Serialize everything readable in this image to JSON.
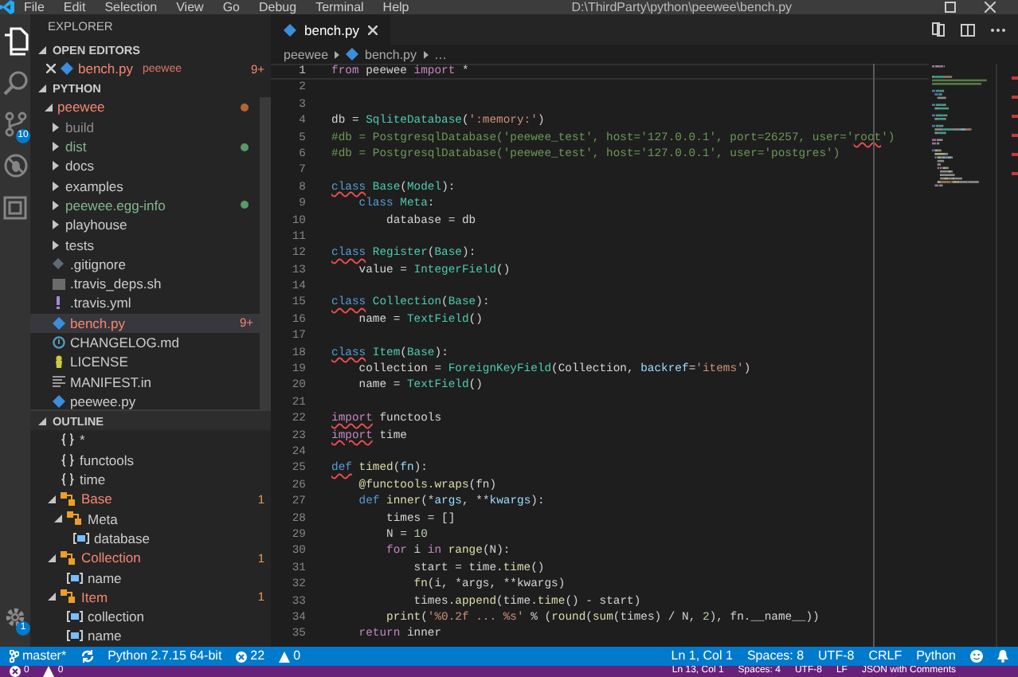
{
  "window": {
    "menu": [
      "File",
      "Edit",
      "Selection",
      "View",
      "Go",
      "Debug",
      "Terminal",
      "Help"
    ],
    "title": "D:\\ThirdParty\\python\\peewee\\bench.py"
  },
  "activity_bar": {
    "items": [
      {
        "selected": true
      },
      {
        "selected": false
      },
      {
        "selected": false,
        "badge": "10"
      },
      {
        "selected": false
      },
      {
        "selected": false
      }
    ],
    "settings": {
      "badge": "1"
    }
  },
  "sidebar": {
    "title": "EXPLORER",
    "open_editors": {
      "title": "OPEN EDITORS",
      "expanded": true,
      "items": [
        {
          "label": "bench.py",
          "description": "peewee",
          "color": "#f48771",
          "badge": "9+",
          "kind": "python"
        }
      ]
    },
    "folder": {
      "title": "PYTHON",
      "expanded": true,
      "items": [
        {
          "label": "peewee",
          "kind": "folder",
          "color": "#f48771",
          "dot": {
            "color": "#b5652e"
          },
          "expanded": true,
          "selected": false,
          "children": [
            {
              "label": "build",
              "kind": "folder",
              "color": "#8c8c8c",
              "expanded": false,
              "selected": false
            },
            {
              "label": "dist",
              "kind": "folder",
              "color": "#81b88b",
              "dot": {
                "color": "#5a9a66"
              },
              "expanded": false,
              "selected": false
            },
            {
              "label": "docs",
              "kind": "folder",
              "color": "#cccccc",
              "expanded": false,
              "selected": false
            },
            {
              "label": "examples",
              "kind": "folder",
              "color": "#cccccc",
              "expanded": false,
              "selected": false
            },
            {
              "label": "peewee.egg-info",
              "kind": "folder",
              "color": "#81b88b",
              "dot": {
                "color": "#5a9a66"
              },
              "expanded": false,
              "selected": false
            },
            {
              "label": "playhouse",
              "kind": "folder",
              "color": "#cccccc",
              "expanded": false,
              "selected": false
            },
            {
              "label": "tests",
              "kind": "folder",
              "color": "#cccccc",
              "expanded": false,
              "selected": false
            },
            {
              "label": ".gitignore",
              "kind": "git",
              "color": "#cccccc",
              "selected": false
            },
            {
              "label": ".travis_deps.sh",
              "kind": "shell",
              "color": "#cccccc",
              "selected": false
            },
            {
              "label": ".travis.yml",
              "kind": "yaml",
              "color": "#cccccc",
              "selected": false
            },
            {
              "label": "bench.py",
              "kind": "python",
              "color": "#f48771",
              "badge": "9+",
              "selected": true
            },
            {
              "label": "CHANGELOG.md",
              "kind": "markdown",
              "color": "#cccccc",
              "selected": false
            },
            {
              "label": "LICENSE",
              "kind": "license",
              "color": "#cccccc",
              "selected": false
            },
            {
              "label": "MANIFEST.in",
              "kind": "manifest",
              "color": "#cccccc",
              "selected": false
            },
            {
              "label": "peewee.py",
              "kind": "python",
              "color": "#cccccc",
              "selected": false
            }
          ]
        }
      ]
    },
    "outline": {
      "title": "OUTLINE",
      "expanded": true,
      "items": [
        {
          "label": "*",
          "kind": "module"
        },
        {
          "label": "functools",
          "kind": "module"
        },
        {
          "label": "time",
          "kind": "module"
        },
        {
          "label": "Base",
          "kind": "class",
          "color": "#f48771",
          "badge": "1",
          "expanded": true,
          "children": [
            {
              "label": "Meta",
              "kind": "class",
              "color": "#cccccc",
              "expanded": true,
              "children": [
                {
                  "label": "database",
                  "kind": "field",
                  "color": "#cccccc"
                }
              ]
            }
          ]
        },
        {
          "label": "Collection",
          "kind": "class",
          "color": "#f48771",
          "badge": "1",
          "expanded": true,
          "children": [
            {
              "label": "name",
              "kind": "field",
              "color": "#cccccc"
            }
          ]
        },
        {
          "label": "Item",
          "kind": "class",
          "color": "#f48771",
          "badge": "1",
          "expanded": true,
          "children": [
            {
              "label": "collection",
              "kind": "field",
              "color": "#cccccc"
            },
            {
              "label": "name",
              "kind": "field",
              "color": "#cccccc"
            }
          ]
        }
      ]
    }
  },
  "editor": {
    "tabs": [
      {
        "label": "bench.py",
        "selected": true
      }
    ],
    "breadcrumbs": [
      "peewee",
      "bench.py",
      "…"
    ],
    "lines": [
      {
        "number": "1",
        "current": true,
        "tokens": [
          {
            "text": "from",
            "color": "#c586c0"
          },
          {
            "text": " peewee "
          },
          {
            "text": "import",
            "color": "#c586c0"
          },
          {
            "text": " *"
          }
        ]
      },
      {
        "number": "2",
        "current": false
      },
      {
        "number": "3",
        "current": false
      },
      {
        "number": "4",
        "current": false,
        "tokens": [
          {
            "text": "db = "
          },
          {
            "text": "SqliteDatabase",
            "color": "#4ec9b0"
          },
          {
            "text": "("
          },
          {
            "text": "':memory:'",
            "color": "#ce9178"
          },
          {
            "text": ")"
          }
        ]
      },
      {
        "number": "5",
        "current": false,
        "tokens": [
          {
            "text": "#db = PostgresqlDatabase('peewee_test', host='127.0.0.1', port=26257, user='",
            "color": "#6a9955"
          },
          {
            "text": "root",
            "color": "#6a9955",
            "squiggle": true
          },
          {
            "text": "')",
            "color": "#6a9955"
          }
        ]
      },
      {
        "number": "6",
        "current": false,
        "tokens": [
          {
            "text": "#db = PostgresqlDatabase('peewee_test', host='127.0.0.1', user='postgres')",
            "color": "#6a9955"
          }
        ]
      },
      {
        "number": "7",
        "current": false
      },
      {
        "number": "8",
        "current": false,
        "tokens": [
          {
            "text": "class",
            "color": "#569cd6",
            "squiggle": true
          },
          {
            "text": " Base",
            "color": "#4ec9b0"
          },
          {
            "text": "("
          },
          {
            "text": "Model",
            "color": "#4ec9b0"
          },
          {
            "text": "):"
          }
        ]
      },
      {
        "number": "9",
        "current": false,
        "tokens": [
          {
            "text": "    class",
            "color": "#569cd6"
          },
          {
            "text": " Meta",
            "color": "#4ec9b0"
          },
          {
            "text": ":"
          }
        ]
      },
      {
        "number": "10",
        "current": false,
        "tokens": [
          {
            "text": "        database = db"
          }
        ]
      },
      {
        "number": "11",
        "current": false
      },
      {
        "number": "12",
        "current": false,
        "tokens": [
          {
            "text": "class",
            "color": "#569cd6",
            "squiggle": true
          },
          {
            "text": " Register",
            "color": "#4ec9b0"
          },
          {
            "text": "("
          },
          {
            "text": "Base",
            "color": "#4ec9b0"
          },
          {
            "text": "):"
          }
        ]
      },
      {
        "number": "13",
        "current": false,
        "tokens": [
          {
            "text": "    value = "
          },
          {
            "text": "IntegerField",
            "color": "#4ec9b0"
          },
          {
            "text": "()"
          }
        ]
      },
      {
        "number": "14",
        "current": false
      },
      {
        "number": "15",
        "current": false,
        "tokens": [
          {
            "text": "class",
            "color": "#569cd6",
            "squiggle": true
          },
          {
            "text": " Collection",
            "color": "#4ec9b0"
          },
          {
            "text": "("
          },
          {
            "text": "Base",
            "color": "#4ec9b0"
          },
          {
            "text": "):"
          }
        ]
      },
      {
        "number": "16",
        "current": false,
        "tokens": [
          {
            "text": "    name = "
          },
          {
            "text": "TextField",
            "color": "#4ec9b0"
          },
          {
            "text": "()"
          }
        ]
      },
      {
        "number": "17",
        "current": false
      },
      {
        "number": "18",
        "current": false,
        "tokens": [
          {
            "text": "class",
            "color": "#569cd6",
            "squiggle": true
          },
          {
            "text": " Item",
            "color": "#4ec9b0"
          },
          {
            "text": "("
          },
          {
            "text": "Base",
            "color": "#4ec9b0"
          },
          {
            "text": "):"
          }
        ]
      },
      {
        "number": "19",
        "current": false,
        "tokens": [
          {
            "text": "    collection = "
          },
          {
            "text": "ForeignKeyField",
            "color": "#4ec9b0"
          },
          {
            "text": "(Collection, "
          },
          {
            "text": "backref",
            "color": "#9cdcfe"
          },
          {
            "text": "="
          },
          {
            "text": "'items'",
            "color": "#ce9178"
          },
          {
            "text": ")"
          }
        ]
      },
      {
        "number": "20",
        "current": false,
        "tokens": [
          {
            "text": "    name = "
          },
          {
            "text": "TextField",
            "color": "#4ec9b0"
          },
          {
            "text": "()"
          }
        ]
      },
      {
        "number": "21",
        "current": false
      },
      {
        "number": "22",
        "current": false,
        "tokens": [
          {
            "text": "import",
            "color": "#c586c0",
            "squiggle": true
          },
          {
            "text": " functools"
          }
        ]
      },
      {
        "number": "23",
        "current": false,
        "tokens": [
          {
            "text": "import",
            "color": "#c586c0",
            "squiggle": true
          },
          {
            "text": " time"
          }
        ]
      },
      {
        "number": "24",
        "current": false
      },
      {
        "number": "25",
        "current": false,
        "tokens": [
          {
            "text": "def",
            "color": "#569cd6",
            "squiggle": true
          },
          {
            "text": " timed",
            "color": "#dcdcaa"
          },
          {
            "text": "("
          },
          {
            "text": "fn",
            "color": "#9cdcfe"
          },
          {
            "text": "):"
          }
        ]
      },
      {
        "number": "26",
        "current": false,
        "tokens": [
          {
            "text": "    @functools.wraps",
            "color": "#dcdcaa"
          },
          {
            "text": "(fn)"
          }
        ]
      },
      {
        "number": "27",
        "current": false,
        "tokens": [
          {
            "text": "    def",
            "color": "#569cd6"
          },
          {
            "text": " inner",
            "color": "#dcdcaa"
          },
          {
            "text": "(*"
          },
          {
            "text": "args",
            "color": "#9cdcfe"
          },
          {
            "text": ", **"
          },
          {
            "text": "kwargs",
            "color": "#9cdcfe"
          },
          {
            "text": "):"
          }
        ]
      },
      {
        "number": "28",
        "current": false,
        "tokens": [
          {
            "text": "        times = []"
          }
        ]
      },
      {
        "number": "29",
        "current": false,
        "tokens": [
          {
            "text": "        N = "
          },
          {
            "text": "10",
            "color": "#b5cea8"
          }
        ]
      },
      {
        "number": "30",
        "current": false,
        "tokens": [
          {
            "text": "        for",
            "color": "#c586c0"
          },
          {
            "text": " i "
          },
          {
            "text": "in",
            "color": "#c586c0"
          },
          {
            "text": " range",
            "color": "#dcdcaa"
          },
          {
            "text": "(N):"
          }
        ]
      },
      {
        "number": "31",
        "current": false,
        "tokens": [
          {
            "text": "            start = time."
          },
          {
            "text": "time",
            "color": "#dcdcaa"
          },
          {
            "text": "()"
          }
        ]
      },
      {
        "number": "32",
        "current": false,
        "tokens": [
          {
            "text": "            fn",
            "color": "#dcdcaa"
          },
          {
            "text": "(i, *args, **kwargs)"
          }
        ]
      },
      {
        "number": "33",
        "current": false,
        "tokens": [
          {
            "text": "            times."
          },
          {
            "text": "append",
            "color": "#dcdcaa"
          },
          {
            "text": "(time."
          },
          {
            "text": "time",
            "color": "#dcdcaa"
          },
          {
            "text": "() - start)"
          }
        ]
      },
      {
        "number": "34",
        "current": false,
        "tokens": [
          {
            "text": "        print",
            "color": "#dcdcaa"
          },
          {
            "text": "("
          },
          {
            "text": "'%0.2f ... %s'",
            "color": "#ce9178"
          },
          {
            "text": " % ("
          },
          {
            "text": "round",
            "color": "#dcdcaa"
          },
          {
            "text": "("
          },
          {
            "text": "sum",
            "color": "#dcdcaa"
          },
          {
            "text": "(times) / N, "
          },
          {
            "text": "2",
            "color": "#b5cea8"
          },
          {
            "text": "), fn.__name__))"
          }
        ]
      },
      {
        "number": "35",
        "current": false,
        "tokens": [
          {
            "text": "    return",
            "color": "#c586c0"
          },
          {
            "text": " inner"
          }
        ]
      }
    ]
  },
  "status_bar": {
    "branch": "master*",
    "interpreter": "Python 2.7.15 64-bit",
    "errors": "22",
    "warnings": "0",
    "right": [
      "Ln 1, Col 1",
      "Spaces: 8",
      "UTF-8",
      "CRLF",
      "Python"
    ]
  },
  "background_status_bar": {
    "errors": "0",
    "warnings": "0",
    "right": [
      "Ln 13, Col 1",
      "Spaces: 4",
      "UTF-8",
      "LF",
      "JSON with Comments"
    ]
  }
}
